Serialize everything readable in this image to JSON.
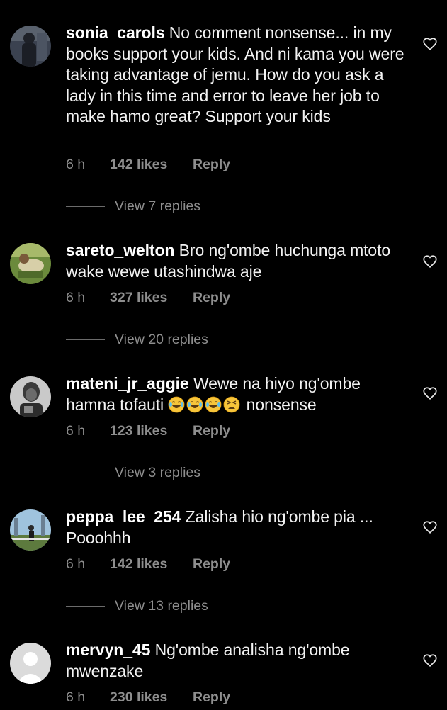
{
  "comments": [
    {
      "username": "sonia_carols",
      "text": "No comment nonsense... in my books support your kids. And ni kama you were taking advantage of jemu. How do you ask a lady in this time and error to leave her job to make hamo great? Support your kids",
      "time": "6 h",
      "likes": "142 likes",
      "reply_label": "Reply",
      "view_replies": "View 7 replies",
      "avatar_icon": "profile-photo"
    },
    {
      "username": "sareto_welton",
      "text": "Bro ng'ombe huchunga mtoto wake wewe utashindwa aje",
      "time": "6 h",
      "likes": "327 likes",
      "reply_label": "Reply",
      "view_replies": "View 20 replies",
      "avatar_icon": "profile-photo"
    },
    {
      "username": "mateni_jr_aggie",
      "text_before": "Wewe na hiyo ng'ombe hamna tofauti",
      "emojis": [
        "tears-of-joy",
        "tears-of-joy",
        "tears-of-joy",
        "tired-face"
      ],
      "text_after": "nonsense",
      "time": "6 h",
      "likes": "123 likes",
      "reply_label": "Reply",
      "view_replies": "View 3 replies",
      "avatar_icon": "profile-photo"
    },
    {
      "username": "peppa_lee_254",
      "text": "Zalisha hio ng'ombe pia ... Pooohhh",
      "time": "6 h",
      "likes": "142 likes",
      "reply_label": "Reply",
      "view_replies": "View 13 replies",
      "avatar_icon": "profile-photo"
    },
    {
      "username": "mervyn_45",
      "text": "Ng'ombe analisha ng'ombe mwenzake",
      "time": "6 h",
      "likes": "230 likes",
      "reply_label": "Reply",
      "avatar_icon": "default-avatar"
    }
  ],
  "icons": {
    "like": "heart-outline-icon"
  },
  "colors": {
    "background": "#000000",
    "text": "#f2f2f2",
    "meta": "#8e8e8e"
  }
}
